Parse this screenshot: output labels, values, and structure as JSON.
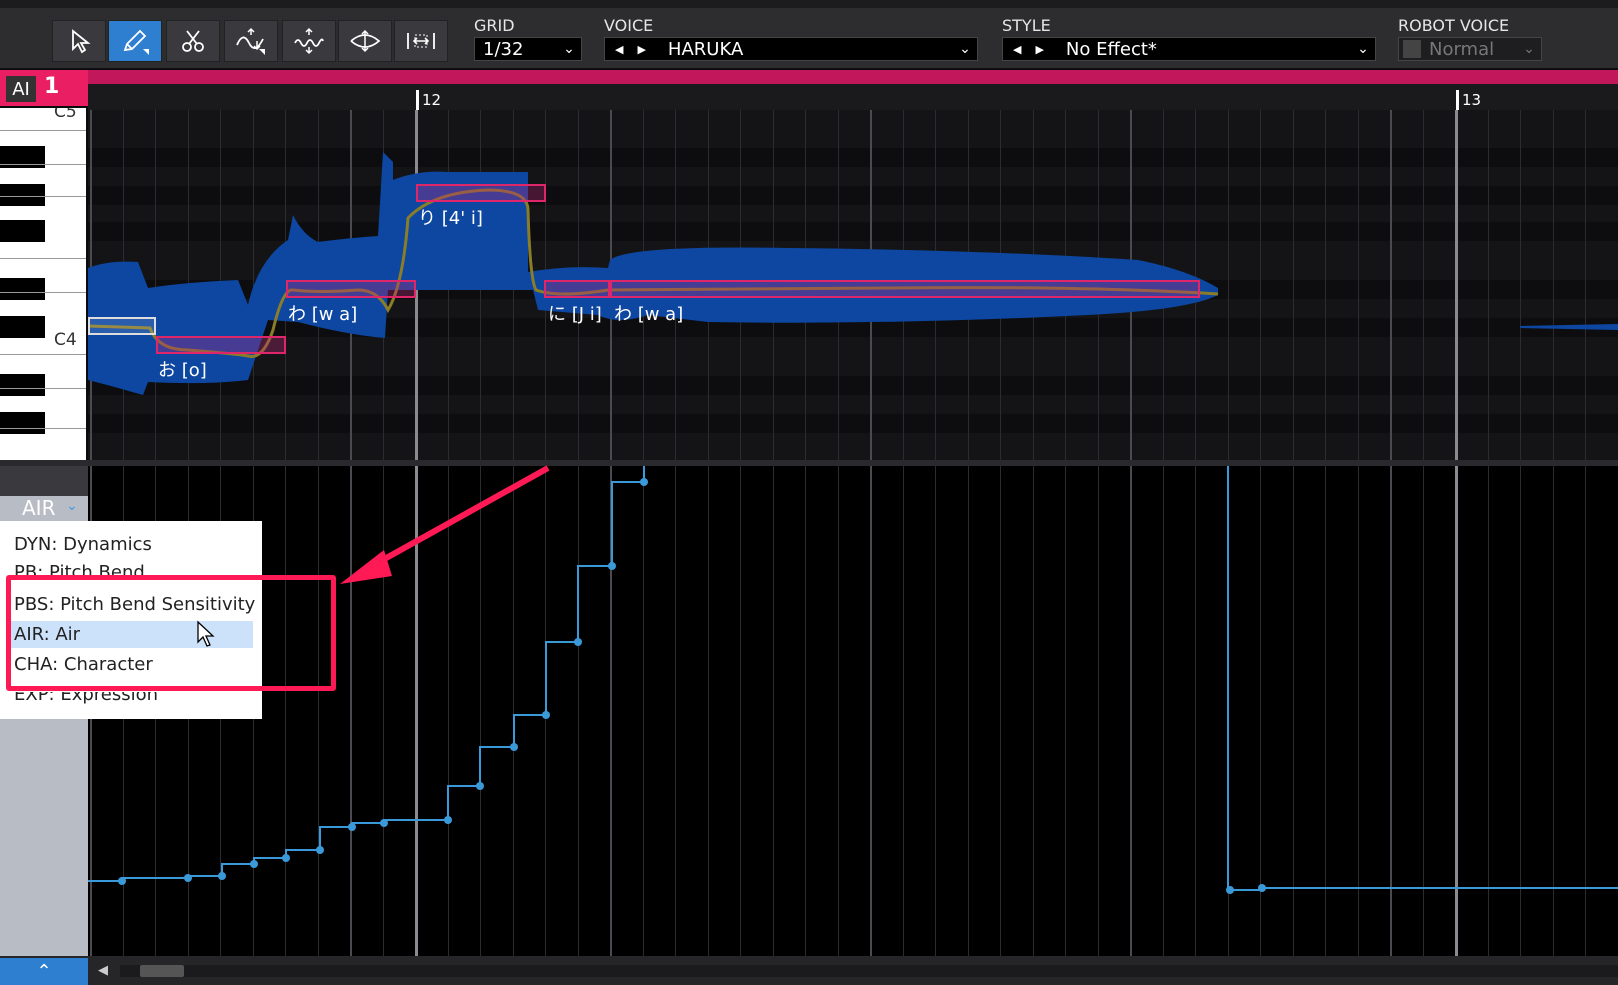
{
  "toolbar": {
    "tools": [
      "arrow-tool",
      "pencil-tool",
      "scissors-tool",
      "pitch-tool",
      "vibrato-tool",
      "timing-tool",
      "stretch-tool"
    ],
    "grid_label": "GRID",
    "grid_value": "1/32",
    "voice_label": "VOICE",
    "voice_value": "HARUKA",
    "style_label": "STYLE",
    "style_value": "No Effect*",
    "robot_label": "ROBOT VOICE",
    "robot_value": "Normal"
  },
  "track": {
    "badge": "AI",
    "number": "1"
  },
  "ruler": {
    "bar1": "12",
    "bar2": "13"
  },
  "piano": {
    "c5": "C5",
    "c4": "C4"
  },
  "lyrics": [
    "お [o]",
    "わ [w a]",
    "り [4' i]",
    "に [J i]",
    "わ [w a]"
  ],
  "param": {
    "current": "AIR"
  },
  "menu": {
    "items": [
      "DYN: Dynamics",
      "PB: Pitch Bend",
      "PBS: Pitch Bend Sensitivity",
      "AIR: Air",
      "CHA: Character",
      "EXP: Expression"
    ],
    "selected": "AIR: Air"
  },
  "colors": {
    "accent": "#e91e63",
    "curve": "#3a9ad9",
    "waveform": "#0d47a1",
    "highlight": "#ff1a55"
  }
}
